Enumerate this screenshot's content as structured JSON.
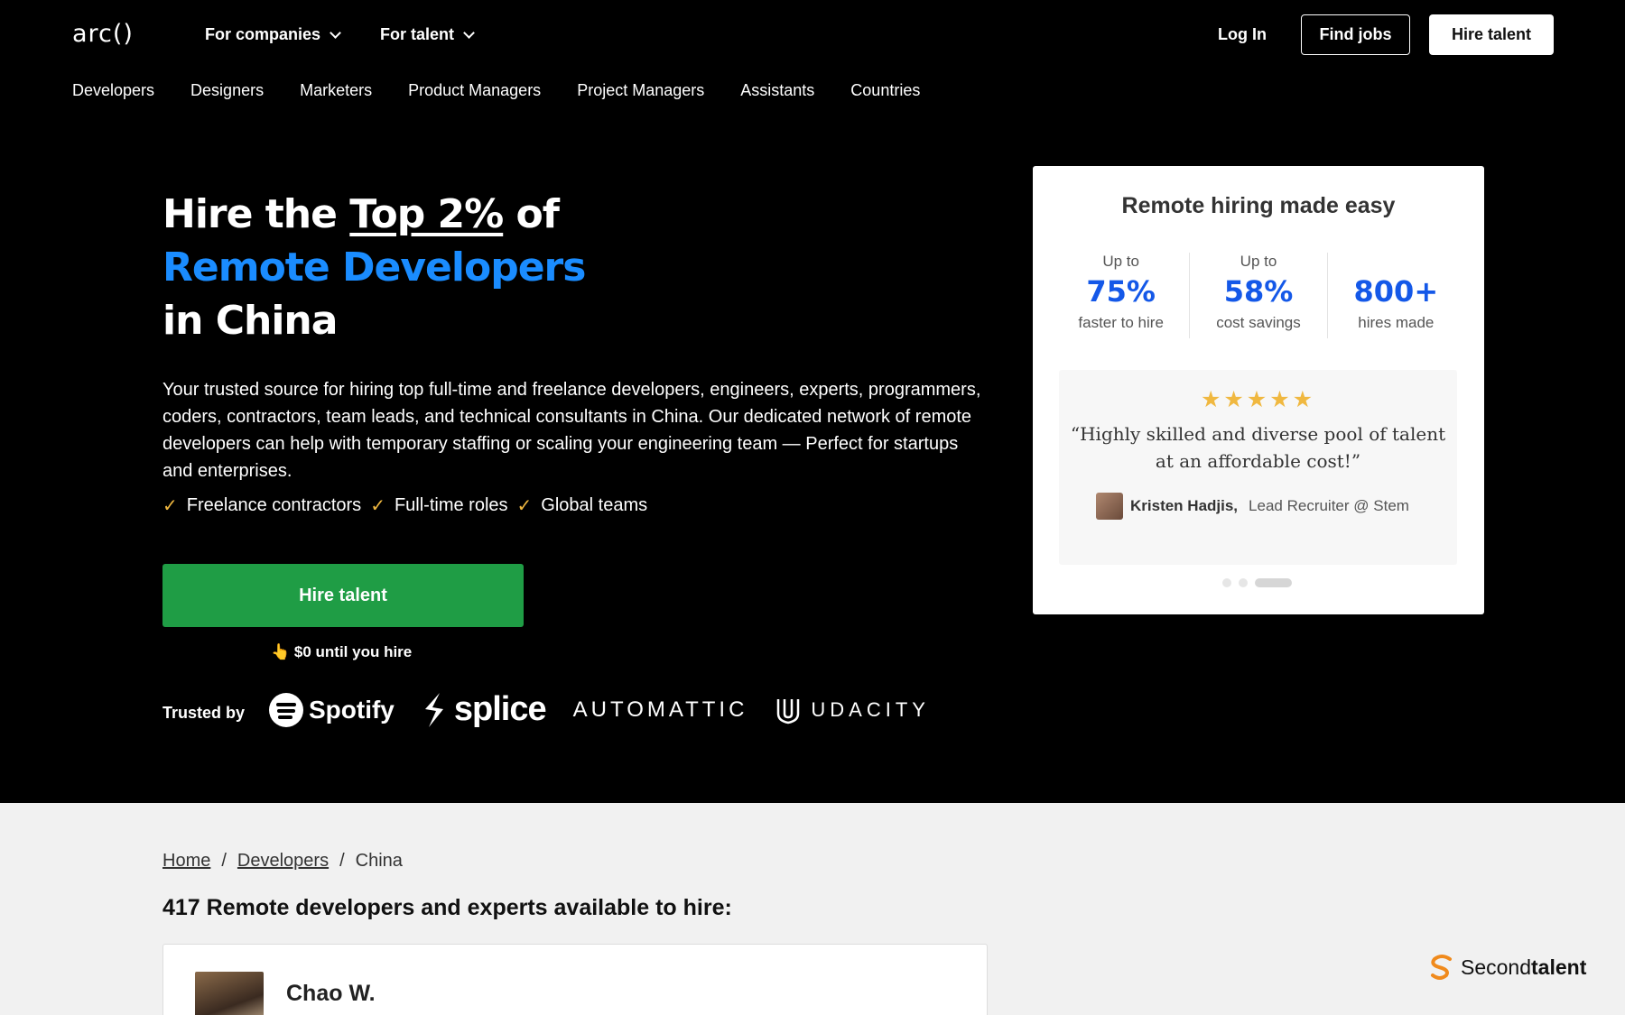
{
  "header": {
    "logo": "arc()",
    "nav": [
      "For companies",
      "For talent"
    ],
    "login": "Log In",
    "find_jobs": "Find jobs",
    "hire_talent": "Hire talent"
  },
  "subnav": [
    "Developers",
    "Designers",
    "Marketers",
    "Product Managers",
    "Project Managers",
    "Assistants",
    "Countries"
  ],
  "hero": {
    "title_part1": "Hire the ",
    "title_highlight": "Top 2%",
    "title_part2": " of",
    "title_line2": "Remote Developers",
    "title_line3": "in China",
    "description": "Your trusted source for hiring top full-time and freelance developers, engineers, experts, programmers, coders, contractors, team leads, and technical consultants in China. Our dedicated network of remote developers can help with temporary staffing or scaling your engineering team — Perfect for startups and enterprises.",
    "checks": [
      "Freelance contractors",
      "Full-time roles",
      "Global teams"
    ],
    "cta": "Hire talent",
    "cta_note": "$0 until you hire",
    "trusted_by": "Trusted by",
    "logos": [
      "Spotify",
      "splice",
      "AUTOMATTIC",
      "UDACITY"
    ]
  },
  "card": {
    "title": "Remote hiring made easy",
    "stats": [
      {
        "prefix": "Up to",
        "value": "75%",
        "label": "faster to hire"
      },
      {
        "prefix": "Up to",
        "value": "58%",
        "label": "cost savings"
      },
      {
        "prefix": "",
        "value": "800+",
        "label": "hires made"
      }
    ],
    "rating": 5,
    "quote": "“Highly skilled and diverse pool of talent at an affordable cost!”",
    "reviewer_name": "Kristen Hadjis,",
    "reviewer_role": "Lead Recruiter @ Stem",
    "carousel_active": 3
  },
  "breadcrumb": [
    "Home",
    "Developers",
    "China"
  ],
  "available_heading": "417 Remote developers and experts available to hire:",
  "developer": {
    "name": "Chao W."
  },
  "badge": {
    "part1": "Second",
    "part2": "talent"
  },
  "colors": {
    "accent_blue": "#1a8cff",
    "stat_blue": "#1458e8",
    "cta_green": "#1f9d45",
    "star": "#f0b840"
  }
}
